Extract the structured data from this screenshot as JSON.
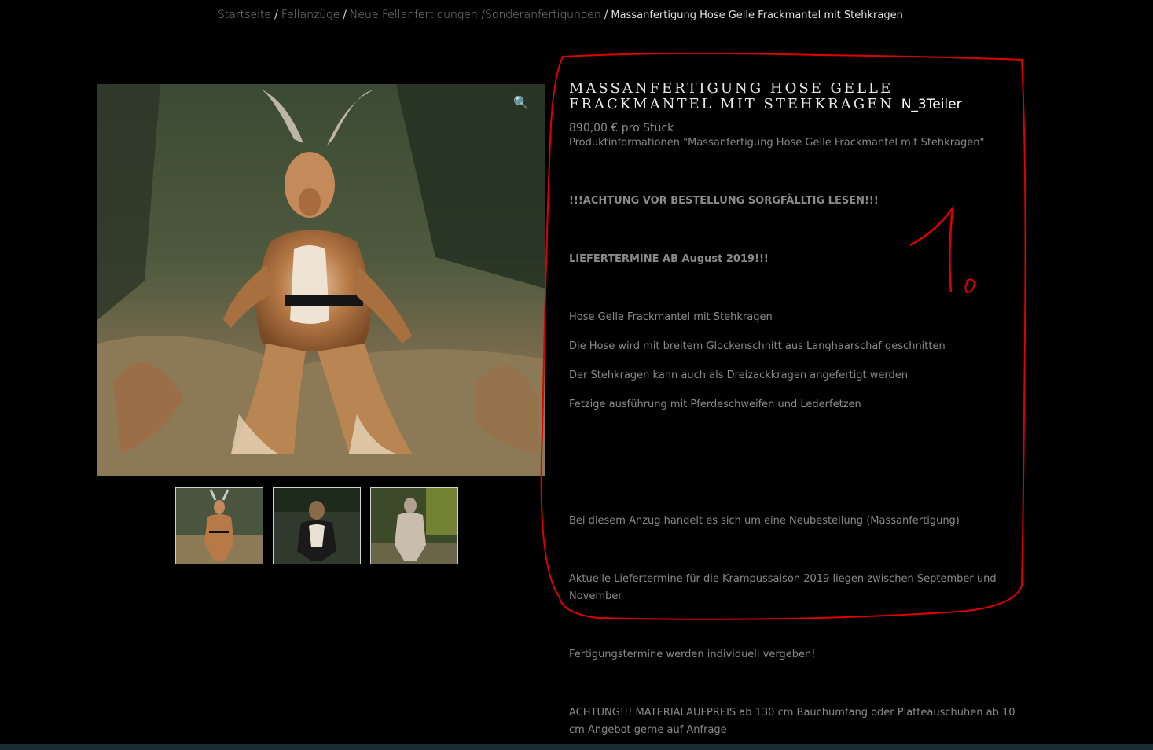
{
  "breadcrumb": {
    "items": [
      "Startseite",
      "Fellanzüge",
      "Neue Fellanfertigungen /Sonderanfertigungen"
    ],
    "separator": "/",
    "current": "Massanfertigung Hose Gelle Frackmantel mit Stehkragen"
  },
  "gallery": {
    "zoom_icon": "magnifier-icon",
    "zoom_glyph": "🔍"
  },
  "product": {
    "title": "Massanfertigung Hose Gelle Frackmantel mit Stehkragen",
    "tag": "N_3Teiler",
    "price": "890,00 € pro Stück"
  },
  "description": [
    "Produktinformationen \"Massanfertigung Hose Gelle Frackmantel mit Stehkragen\"",
    "!!!ACHTUNG VOR BESTELLUNG SORGFÄLLTIG LESEN!!!",
    "LIEFERTERMINE AB August 2019!!!",
    "Hose Gelle Frackmantel mit Stehkragen",
    "Die Hose wird mit breitem Glockenschnitt aus Langhaarschaf geschnitten",
    "Der Stehkragen kann auch als Dreizackkragen angefertigt werden",
    "Fetzige ausführung mit Pferdeschweifen und Lederfetzen",
    "Bei diesem Anzug handelt es sich um eine Neubestellung (Massanfertigung)",
    "Aktuelle Liefertermine für die Krampussaison 2019 liegen zwischen September und November",
    "Fertigungstermine werden individuell vergeben!",
    "ACHTUNG!!! MATERIALAUFPREIS  ab 130 cm Bauchumfang  oder Platteauschuhen ab 10 cm  Angebot gerne auf Anfrage"
  ],
  "annotation": {
    "color": "#e00000",
    "label": "1."
  }
}
